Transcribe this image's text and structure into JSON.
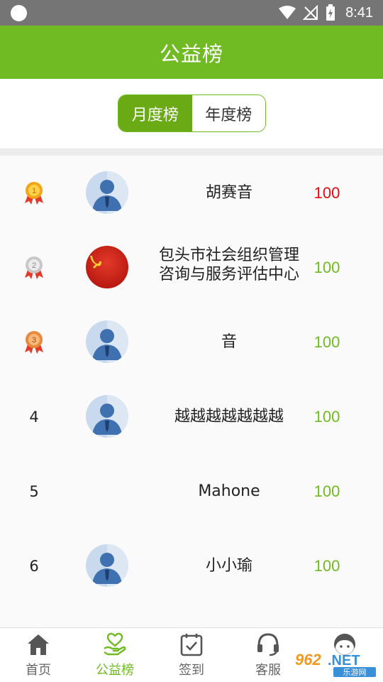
{
  "status_bar": {
    "time": "8:41"
  },
  "header": {
    "title": "公益榜"
  },
  "tabs": [
    {
      "label": "月度榜",
      "active": true
    },
    {
      "label": "年度榜",
      "active": false
    }
  ],
  "ranking": [
    {
      "rank": "1",
      "medal": "gold-medal",
      "avatar": "default-user-avatar",
      "name": "胡赛音",
      "score": "100",
      "score_color": "#e5090f"
    },
    {
      "rank": "2",
      "medal": "silver-medal",
      "avatar": "party-flag-avatar",
      "name": "包头市社会组织管理咨询与服务评估中心",
      "score": "100",
      "score_color": "#70ba24"
    },
    {
      "rank": "3",
      "medal": "bronze-medal",
      "avatar": "default-user-avatar",
      "name": "音",
      "score": "100",
      "score_color": "#70ba24"
    },
    {
      "rank": "4",
      "avatar": "default-user-avatar",
      "name": "越越越越越越越",
      "score": "100",
      "score_color": "#70ba24"
    },
    {
      "rank": "5",
      "avatar": "",
      "name": "Mahone",
      "score": "100",
      "score_color": "#70ba24"
    },
    {
      "rank": "6",
      "avatar": "default-user-avatar",
      "name": "小小瑜",
      "score": "100",
      "score_color": "#70ba24"
    }
  ],
  "bottom_nav": [
    {
      "label": "首页",
      "icon": "home-icon",
      "active": false
    },
    {
      "label": "公益榜",
      "icon": "heart-hand-icon",
      "active": true
    },
    {
      "label": "签到",
      "icon": "checkin-calendar-icon",
      "active": false
    },
    {
      "label": "客服",
      "icon": "headset-icon",
      "active": false
    },
    {
      "label": "",
      "icon": "profile-face-icon",
      "active": false
    }
  ],
  "colors": {
    "brand_green": "#70ba24",
    "top_score_red": "#e5090f"
  },
  "watermark": "962.NET 乐游网"
}
